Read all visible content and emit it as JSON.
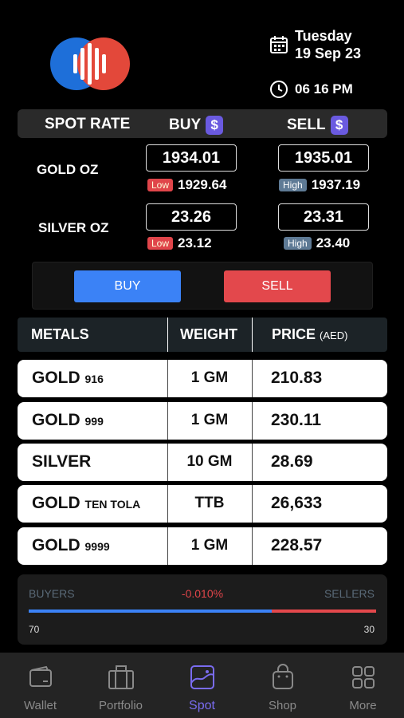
{
  "header": {
    "day": "Tuesday",
    "date": "19 Sep 23",
    "time": "06 16 PM"
  },
  "spot": {
    "title": "SPOT RATE",
    "buy_label": "BUY",
    "sell_label": "SELL",
    "currency_symbol": "$",
    "rows": [
      {
        "label": "GOLD OZ",
        "buy": "1934.01",
        "sell": "1935.01",
        "low_tag": "Low",
        "low": "1929.64",
        "high_tag": "High",
        "high": "1937.19"
      },
      {
        "label": "SILVER OZ",
        "buy": "23.26",
        "sell": "23.31",
        "low_tag": "Low",
        "low": "23.12",
        "high_tag": "High",
        "high": "23.40"
      }
    ]
  },
  "actions": {
    "buy": "BUY",
    "sell": "SELL"
  },
  "table": {
    "headers": {
      "metals": "METALS",
      "weight": "WEIGHT",
      "price": "PRICE",
      "price_unit": "(AED)"
    },
    "rows": [
      {
        "name": "GOLD",
        "sub": "916",
        "weight": "1 GM",
        "price": "210.83"
      },
      {
        "name": "GOLD",
        "sub": "999",
        "weight": "1 GM",
        "price": "230.11"
      },
      {
        "name": "SILVER",
        "sub": "",
        "weight": "10 GM",
        "price": "28.69"
      },
      {
        "name": "GOLD",
        "sub": "TEN TOLA",
        "weight": "TTB",
        "price": "26,633"
      },
      {
        "name": "GOLD",
        "sub": "9999",
        "weight": "1 GM",
        "price": "228.57"
      }
    ]
  },
  "sentiment": {
    "buyers_label": "BUYERS",
    "sellers_label": "SELLERS",
    "change": "-0.010%",
    "buyers": "70",
    "sellers": "30",
    "buyers_fraction": 0.7
  },
  "nav": [
    {
      "label": "Wallet",
      "icon": "wallet-icon"
    },
    {
      "label": "Portfolio",
      "icon": "briefcase-icon"
    },
    {
      "label": "Spot",
      "icon": "chart-image-icon",
      "active": true
    },
    {
      "label": "Shop",
      "icon": "shopping-bag-icon"
    },
    {
      "label": "More",
      "icon": "grid-icon"
    }
  ],
  "colors": {
    "accent": "#7a6cf0",
    "buy": "#3b82f6",
    "sell": "#e3484c",
    "logo_blue": "#1e6fd9",
    "logo_red": "#e3483a"
  }
}
